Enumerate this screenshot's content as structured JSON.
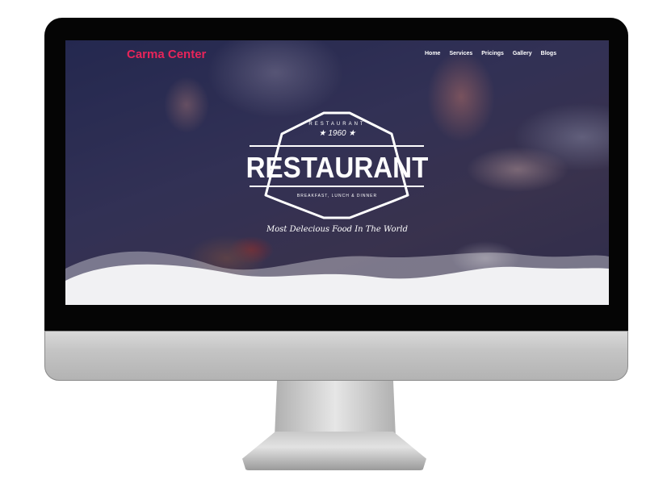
{
  "site": {
    "brand": "Carma Center",
    "brand_color": "#e8245a"
  },
  "nav": {
    "items": [
      "Home",
      "Services",
      "Pricings",
      "Gallery",
      "Blogs"
    ]
  },
  "hero": {
    "badge_top": "RESTAURANT",
    "badge_year": "★ 1960 ★",
    "title": "RESTAURANT",
    "badge_bottom": "BREAKFAST, LUNCH & DINNER",
    "tagline": "Most Delecious Food In The World"
  }
}
